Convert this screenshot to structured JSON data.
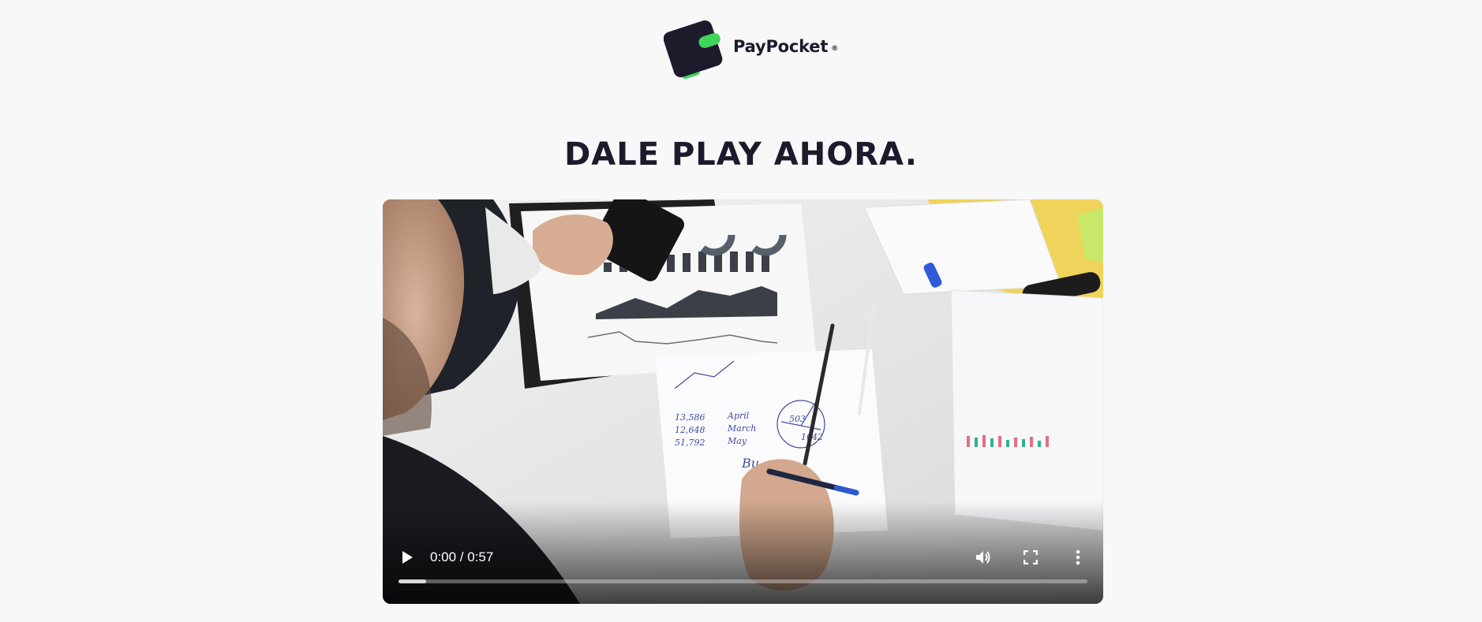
{
  "brand": {
    "name": "PayPocket",
    "registered_mark": "®",
    "colors": {
      "dark": "#1c1a2b",
      "accent": "#3fd45a"
    }
  },
  "heading": "DALE PLAY AHORA.",
  "video": {
    "time_display": "0:00 / 0:57",
    "progress": 0,
    "buffered_fraction": 0.04,
    "controls": {
      "play": "play-icon",
      "volume": "volume-icon",
      "fullscreen": "fullscreen-icon",
      "more": "more-options-icon"
    }
  }
}
